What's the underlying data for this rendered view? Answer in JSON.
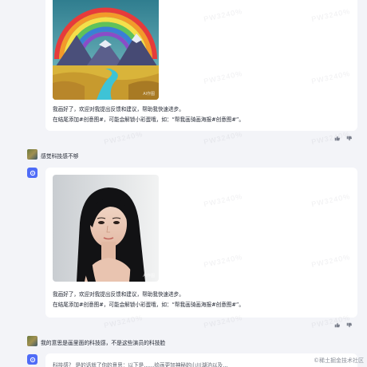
{
  "watermark_text": "PW3240%",
  "messages": [
    {
      "role": "bot",
      "image_tag": "AI作图",
      "line1": "我画好了，欢迎对我提出反馈和建议，帮助我快速进步。",
      "line2": "在结尾添加#创意图#，可能会解锁小彩蛋哦，如：“帮我画骑画海报#创意图#”。"
    },
    {
      "role": "user",
      "text": "感觉科技感不够"
    },
    {
      "role": "bot",
      "image_tag": "AI作图",
      "line1": "我画好了，欢迎对我提出反馈和建议，帮助我快速进步。",
      "line2": "在结尾添加#创意图#，可能会解锁小彩蛋哦，如：“帮我画骑画海报#创意图#”。"
    },
    {
      "role": "user",
      "text": "我的意思是画里面的科技感，不是这些演员的科技脸"
    },
    {
      "role": "bot",
      "partial_text": "科技感？ 是的话就了你的意思：以下是……绘画更加神秘的山川湖泊以及…"
    }
  ],
  "footer": "©稀土掘金技术社区"
}
